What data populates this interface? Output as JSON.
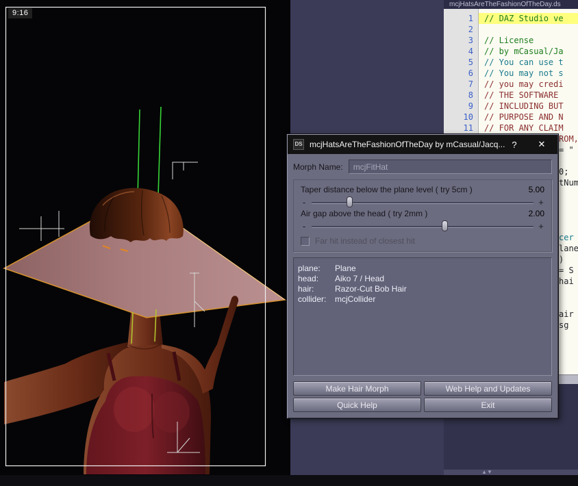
{
  "viewport": {
    "aspect_label": "9:16"
  },
  "editor": {
    "title": "mcjHatsAreTheFashionOfTheDay.ds",
    "lines": [
      {
        "num": "1",
        "text": "// DAZ Studio ve"
      },
      {
        "num": "2",
        "text": ""
      },
      {
        "num": "3",
        "text": "// License"
      },
      {
        "num": "4",
        "text": "// by mCasual/Ja"
      },
      {
        "num": "5",
        "text": "// You can use t"
      },
      {
        "num": "6",
        "text": "// You may not s"
      },
      {
        "num": "7",
        "text": "// you may credi"
      },
      {
        "num": "8",
        "text": "// THE SOFTWARE"
      },
      {
        "num": "9",
        "text": "// INCLUDING BUT"
      },
      {
        "num": "10",
        "text": "// PURPOSE AND N"
      },
      {
        "num": "11",
        "text": "// FOR ANY CLAIM"
      }
    ],
    "fragments": [
      {
        "text": "ROM,"
      },
      {
        "text": "= \""
      },
      {
        "text": "0;"
      },
      {
        "text": "tNum"
      },
      {
        "text": "cer"
      },
      {
        "text": "lane"
      },
      {
        "text": ")"
      },
      {
        "text": "= S"
      },
      {
        "text": "hai"
      },
      {
        "text": "air"
      },
      {
        "text": "sg"
      }
    ]
  },
  "dialog": {
    "icon": "DS",
    "title": "mcjHatsAreTheFashionOfTheDay by mCasual/Jacq...",
    "help_button": "?",
    "close_button": "✕",
    "morph_name_label": "Morph Name:",
    "morph_name_value": "mcjFitHat",
    "sliders": [
      {
        "label": "Taper distance below the plane level ( try 5cm )",
        "value": "5.00",
        "minus": "-",
        "plus": "+"
      },
      {
        "label": "Air gap above the head ( try 2mm )",
        "value": "2.00",
        "minus": "-",
        "plus": "+"
      }
    ],
    "checkbox_label": "Far hit instead of closest hit",
    "checkbox_checked": false,
    "info": [
      {
        "label": "plane:",
        "value": "Plane"
      },
      {
        "label": "head:",
        "value": "Aiko 7 / Head"
      },
      {
        "label": "hair:",
        "value": "Razor-Cut Bob Hair"
      },
      {
        "label": "collider:",
        "value": "mcjCollider"
      }
    ],
    "buttons": [
      "Make Hair Morph",
      "Web Help and Updates",
      "Quick Help",
      "Exit"
    ]
  },
  "colors": {
    "dialog_bg": "#6c6c80",
    "plane_edge_orange": "#d6922c",
    "highlight_line_yellow": "#ffff7e",
    "guide_green": "#37d437"
  }
}
